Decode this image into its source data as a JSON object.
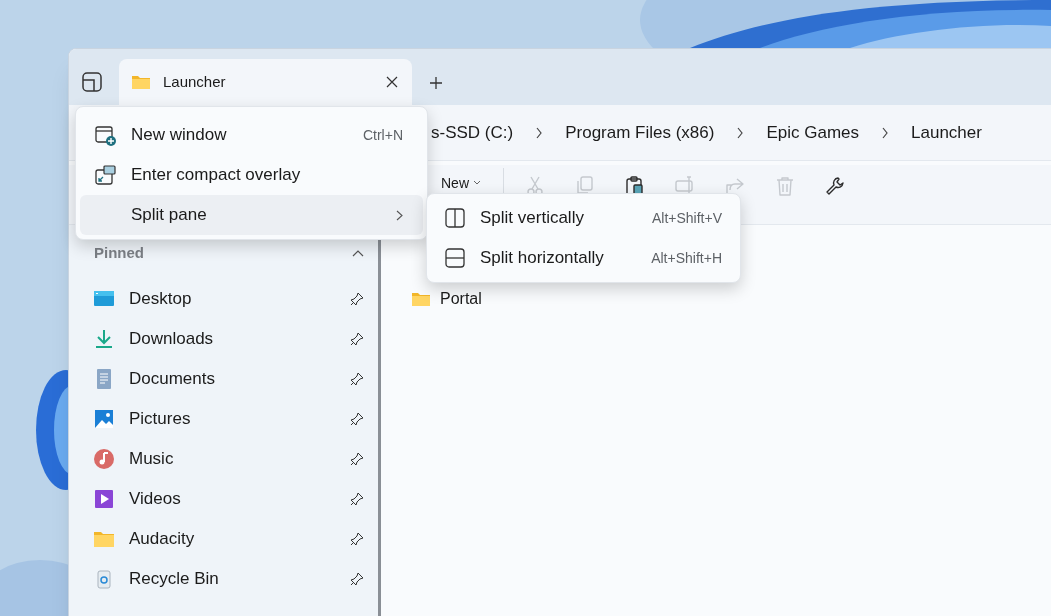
{
  "tabs": [
    {
      "label": "Launcher",
      "selected": true
    }
  ],
  "breadcrumb": [
    "s-SSD (C:)",
    "Program Files (x86)",
    "Epic Games",
    "Launcher"
  ],
  "toolbar": {
    "new_label": "New",
    "buttons": [
      {
        "kind": "cut",
        "disabled": true
      },
      {
        "kind": "copy",
        "disabled": true
      },
      {
        "kind": "paste",
        "disabled": false
      },
      {
        "kind": "rename",
        "disabled": true
      },
      {
        "kind": "share",
        "disabled": true
      },
      {
        "kind": "delete",
        "disabled": true
      },
      {
        "kind": "properties",
        "disabled": false
      }
    ]
  },
  "sidebar": {
    "section": "Pinned",
    "expanded": true,
    "items": [
      {
        "label": "Desktop",
        "kind": "desktop"
      },
      {
        "label": "Downloads",
        "kind": "downloads"
      },
      {
        "label": "Documents",
        "kind": "documents"
      },
      {
        "label": "Pictures",
        "kind": "pictures"
      },
      {
        "label": "Music",
        "kind": "music"
      },
      {
        "label": "Videos",
        "kind": "videos"
      },
      {
        "label": "Audacity",
        "kind": "folder"
      },
      {
        "label": "Recycle Bin",
        "kind": "recycle"
      }
    ]
  },
  "files": [
    {
      "name": "Portal",
      "kind": "folder"
    }
  ],
  "menu": [
    {
      "label": "New window",
      "shortcut": "Ctrl+N",
      "kind": "new-window",
      "selected": false
    },
    {
      "label": "Enter compact overlay",
      "kind": "overlay",
      "selected": false
    },
    {
      "label": "Split pane",
      "kind": "split",
      "selected": true,
      "has_submenu": true
    }
  ],
  "submenu": [
    {
      "label": "Split vertically",
      "shortcut": "Alt+Shift+V",
      "kind": "vertical"
    },
    {
      "label": "Split horizontally",
      "shortcut": "Alt+Shift+H",
      "kind": "horizontal"
    }
  ]
}
